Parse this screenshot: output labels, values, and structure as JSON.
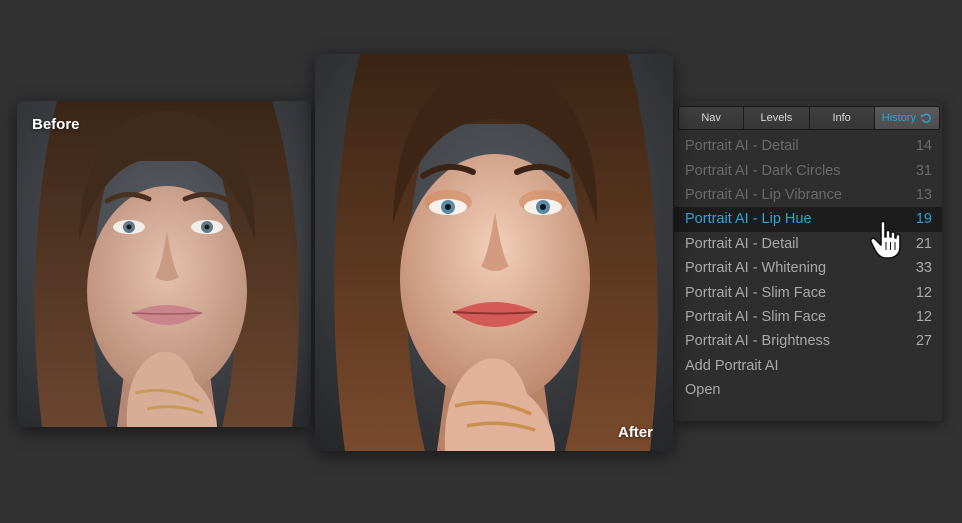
{
  "before_label": "Before",
  "after_label": "After",
  "panel": {
    "tabs": [
      {
        "label": "Nav",
        "active": false
      },
      {
        "label": "Levels",
        "active": false
      },
      {
        "label": "Info",
        "active": false
      },
      {
        "label": "History",
        "active": true,
        "icon": "undo-icon"
      }
    ],
    "history": [
      {
        "label": "Portrait AI - Detail",
        "count": "14",
        "state": "dimmed"
      },
      {
        "label": "Portrait AI - Dark Circles",
        "count": "31",
        "state": "dimmed"
      },
      {
        "label": "Portrait AI - Lip Vibrance",
        "count": "13",
        "state": "dimmed"
      },
      {
        "label": "Portrait AI - Lip Hue",
        "count": "19",
        "state": "selected"
      },
      {
        "label": "Portrait AI - Detail",
        "count": "21",
        "state": "normal"
      },
      {
        "label": "Portrait AI - Whitening",
        "count": "33",
        "state": "normal"
      },
      {
        "label": "Portrait AI - Slim Face",
        "count": "12",
        "state": "normal"
      },
      {
        "label": "Portrait AI - Slim Face",
        "count": "12",
        "state": "normal"
      },
      {
        "label": "Portrait AI - Brightness",
        "count": "27",
        "state": "normal"
      },
      {
        "label": "Add Portrait AI",
        "count": "",
        "state": "normal"
      },
      {
        "label": "Open",
        "count": "",
        "state": "normal"
      }
    ]
  },
  "colors": {
    "accent": "#2ea3d6",
    "background": "#323232",
    "panel": "#2e2e2e"
  }
}
